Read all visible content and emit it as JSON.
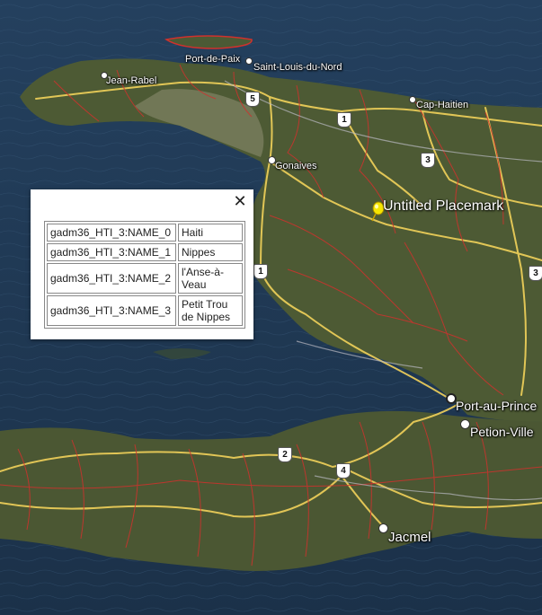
{
  "map": {
    "placemark": {
      "label": "Untitled Placemark",
      "icon": "yellow-pushpin-icon"
    },
    "cities": [
      {
        "id": "jean-rabel",
        "name": "Jean-Rabel"
      },
      {
        "id": "port-de-paix",
        "name": "Port-de-Paix"
      },
      {
        "id": "saint-louis-du-nord",
        "name": "Saint-Louis-du-Nord"
      },
      {
        "id": "cap-haitien",
        "name": "Cap-Haitien"
      },
      {
        "id": "gonaives",
        "name": "Gonaives"
      },
      {
        "id": "port-au-prince",
        "name": "Port-au-Prince"
      },
      {
        "id": "petion-ville",
        "name": "Petion-Ville"
      },
      {
        "id": "jacmel",
        "name": "Jacmel"
      }
    ],
    "route_shields": [
      "5",
      "1",
      "3",
      "1",
      "3",
      "2",
      "4"
    ],
    "colors": {
      "roads": "#f2d25a",
      "boundaries": "#d0312d",
      "water": "#1c3550",
      "land": "#4c5a33"
    }
  },
  "popup": {
    "close_icon": "close-icon",
    "rows": [
      {
        "key": "gadm36_HTI_3:NAME_0",
        "value": "Haiti"
      },
      {
        "key": "gadm36_HTI_3:NAME_1",
        "value": "Nippes"
      },
      {
        "key": "gadm36_HTI_3:NAME_2",
        "value": "l'Anse-à-Veau"
      },
      {
        "key": "gadm36_HTI_3:NAME_3",
        "value": "Petit Trou de Nippes"
      }
    ]
  }
}
